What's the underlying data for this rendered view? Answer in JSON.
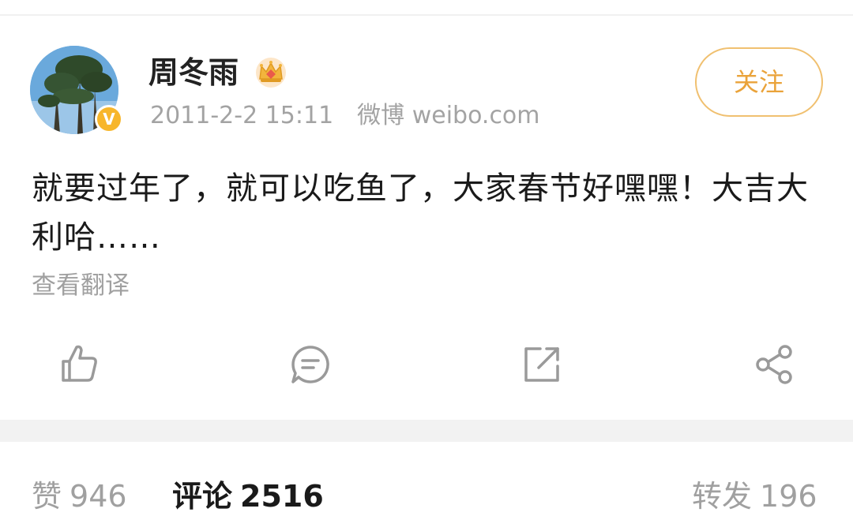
{
  "post": {
    "author": {
      "name": "周冬雨",
      "verified_badge": "V",
      "avatar_icon": "tree-avatar",
      "member_icon": "crown-icon"
    },
    "timestamp": "2011-2-2 15:11",
    "source": "微博 weibo.com",
    "follow_label": "关注",
    "text": "就要过年了，就可以吃鱼了，大家春节好嘿嘿！大吉大利哈……",
    "translate_label": "查看翻译"
  },
  "actions": [
    {
      "name": "like",
      "icon": "thumbs-up-icon"
    },
    {
      "name": "comment",
      "icon": "comment-icon"
    },
    {
      "name": "repost",
      "icon": "repost-icon"
    },
    {
      "name": "share",
      "icon": "share-icon"
    }
  ],
  "stats": {
    "likes_label": "赞",
    "likes_count": "946",
    "comments_label": "评论",
    "comments_count": "2516",
    "reposts_label": "转发",
    "reposts_count": "196"
  },
  "colors": {
    "follow_accent": "#eaa33a",
    "verified_badge": "#f7b62b",
    "muted_text": "#a3a3a3"
  }
}
